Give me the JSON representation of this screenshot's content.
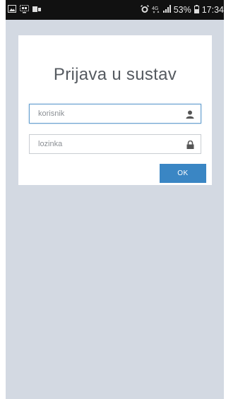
{
  "status_bar": {
    "battery_percent": "53%",
    "time": "17:34",
    "network": "4G",
    "icons": [
      "image-icon",
      "screen-mirror-icon",
      "cast-icon",
      "alarm-icon",
      "network-4g-icon",
      "signal-icon",
      "battery-icon"
    ]
  },
  "login": {
    "title": "Prijava u sustav",
    "username_placeholder": "korisnik",
    "password_placeholder": "lozinka",
    "ok_label": "OK"
  },
  "colors": {
    "background": "#d3d9e2",
    "card": "#ffffff",
    "button": "#3a86c4",
    "input_focus_border": "#66a0cf",
    "status_bar": "#111111"
  }
}
